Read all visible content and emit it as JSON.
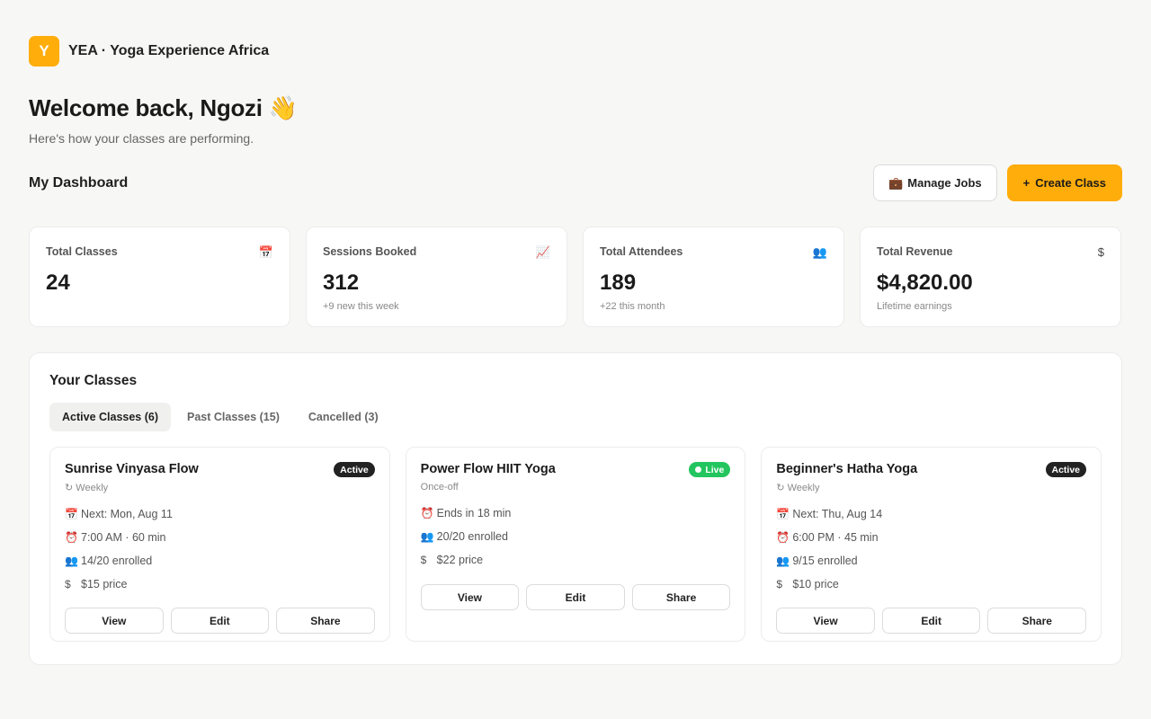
{
  "brand": {
    "logo_letter": "Y",
    "name": "YEA · Yoga Experience Africa",
    "accent": "#ffad0a"
  },
  "header": {
    "welcome": "Welcome back, Ngozi 👋",
    "subtitle": "Here's how your classes are performing."
  },
  "dashboard": {
    "title": "My Dashboard",
    "manage_jobs_icon": "💼",
    "manage_jobs_label": "Manage Jobs",
    "create_class_icon": "+",
    "create_class_label": "Create Class"
  },
  "stats": [
    {
      "label": "Total Classes",
      "icon": "📅",
      "icon_name": "calendar-icon",
      "value": "24",
      "note": ""
    },
    {
      "label": "Sessions Booked",
      "icon": "📈",
      "icon_name": "chart-up-icon",
      "value": "312",
      "note": "+9 new this week"
    },
    {
      "label": "Total Attendees",
      "icon": "👥",
      "icon_name": "people-icon",
      "value": "189",
      "note": "+22 this month"
    },
    {
      "label": "Total Revenue",
      "icon": "$",
      "icon_name": "dollar-icon",
      "value": "$4,820.00",
      "note": "Lifetime earnings"
    }
  ],
  "classes": {
    "title": "Your Classes",
    "tabs": [
      {
        "label": "Active Classes (6)",
        "active": true
      },
      {
        "label": "Past Classes (15)",
        "active": false
      },
      {
        "label": "Cancelled (3)",
        "active": false
      }
    ],
    "cards": [
      {
        "title": "Sunrise Vinyasa Flow",
        "badge": "Active",
        "badge_style": "dark",
        "frequency": "↻ Weekly",
        "meta": [
          {
            "icon": "📅",
            "text": "Next: Mon, Aug 11"
          },
          {
            "icon": "⏰",
            "text": "7:00 AM · 60 min"
          },
          {
            "icon": "👥",
            "text": "14/20 enrolled"
          },
          {
            "icon": "$",
            "text": "$15 price"
          }
        ],
        "actions": [
          "View",
          "Edit",
          "Share"
        ]
      },
      {
        "title": "Power Flow HIIT Yoga",
        "badge": "Live",
        "badge_style": "live",
        "frequency": "Once-off",
        "meta": [
          {
            "icon": "⏰",
            "text": "Ends in 18 min"
          },
          {
            "icon": "👥",
            "text": "20/20 enrolled"
          },
          {
            "icon": "$",
            "text": "$22 price"
          }
        ],
        "actions": [
          "View",
          "Edit",
          "Share"
        ]
      },
      {
        "title": "Beginner's Hatha Yoga",
        "badge": "Active",
        "badge_style": "dark",
        "frequency": "↻ Weekly",
        "meta": [
          {
            "icon": "📅",
            "text": "Next: Thu, Aug 14"
          },
          {
            "icon": "⏰",
            "text": "6:00 PM · 45 min"
          },
          {
            "icon": "👥",
            "text": "9/15 enrolled"
          },
          {
            "icon": "$",
            "text": "$10 price"
          }
        ],
        "actions": [
          "View",
          "Edit",
          "Share"
        ]
      }
    ]
  }
}
